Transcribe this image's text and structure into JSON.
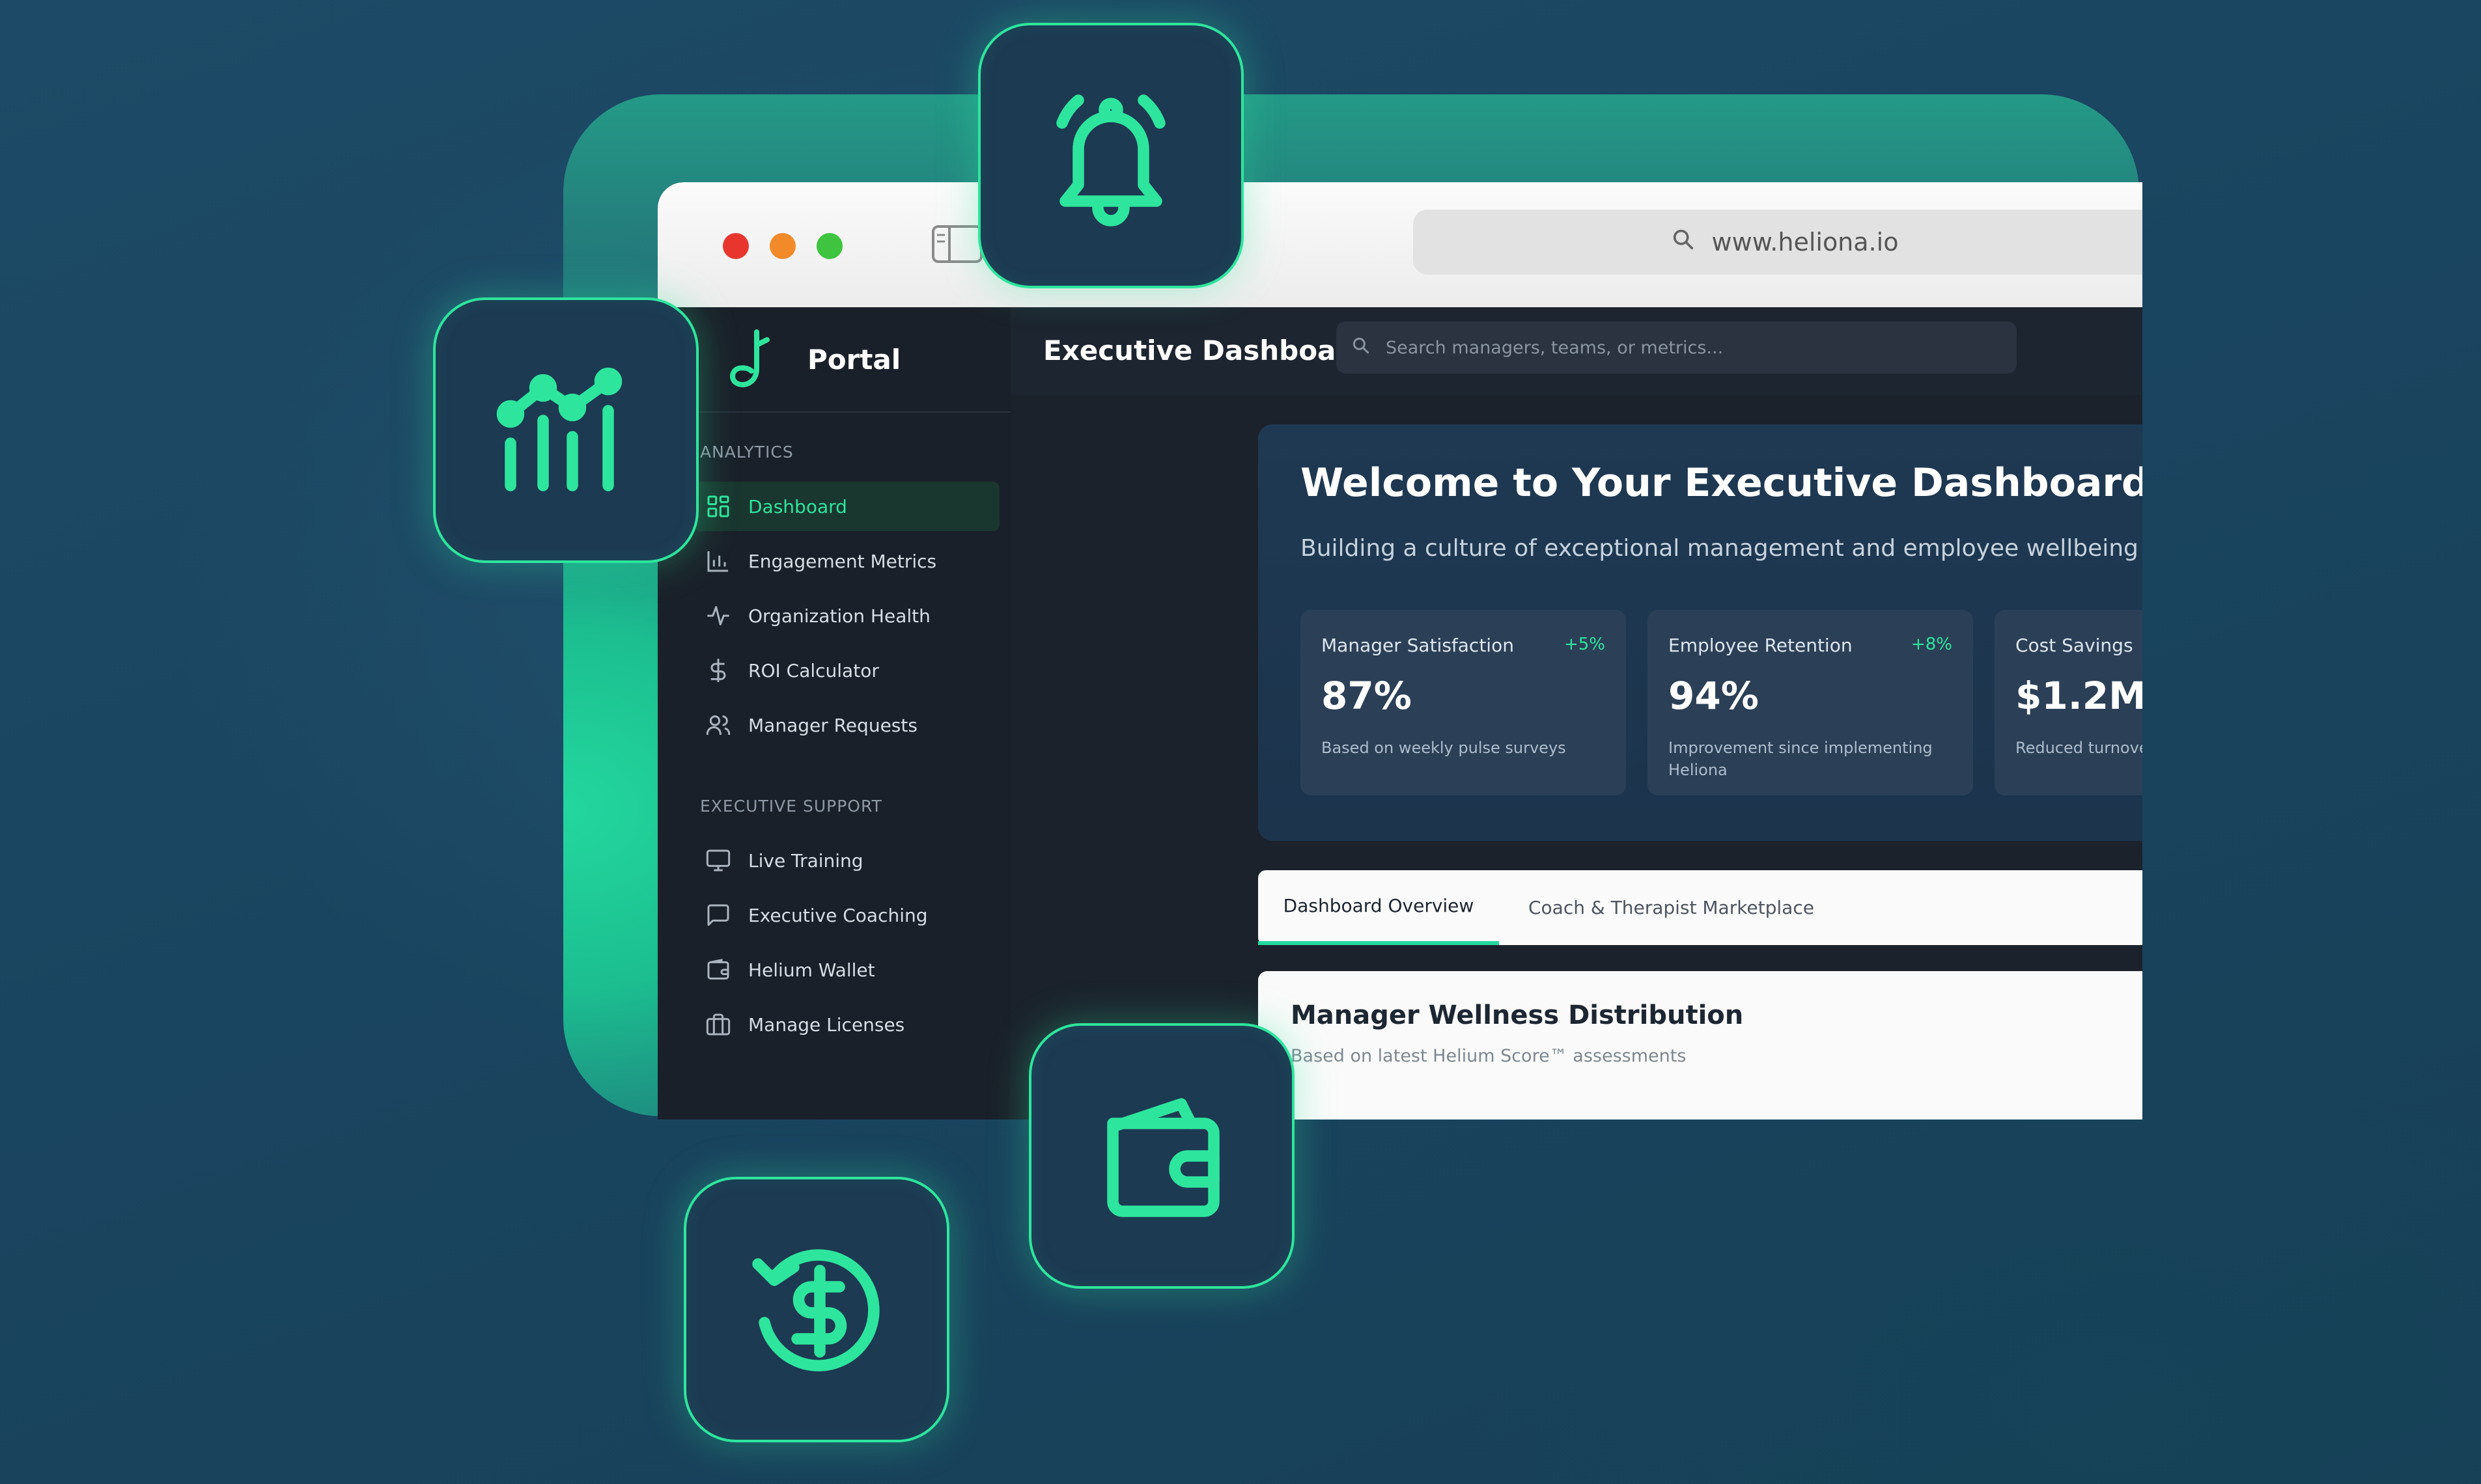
{
  "browser": {
    "url": "www.heliona.io"
  },
  "sidebar": {
    "brand": "Portal",
    "sections": [
      {
        "label": "ANALYTICS",
        "items": [
          {
            "label": "Dashboard",
            "icon": "grid-icon",
            "active": true
          },
          {
            "label": "Engagement Metrics",
            "icon": "bar-chart-icon"
          },
          {
            "label": "Organization Health",
            "icon": "pulse-icon"
          },
          {
            "label": "ROI Calculator",
            "icon": "dollar-icon"
          },
          {
            "label": "Manager Requests",
            "icon": "users-icon"
          }
        ]
      },
      {
        "label": "EXECUTIVE SUPPORT",
        "items": [
          {
            "label": "Live Training",
            "icon": "monitor-icon"
          },
          {
            "label": "Executive Coaching",
            "icon": "chat-icon"
          },
          {
            "label": "Helium Wallet",
            "icon": "wallet-icon"
          },
          {
            "label": "Manage Licenses",
            "icon": "briefcase-icon"
          }
        ]
      }
    ]
  },
  "header": {
    "title": "Executive Dashboard",
    "search_placeholder": "Search managers, teams, or metrics..."
  },
  "welcome": {
    "title": "Welcome to Your Executive Dashboard",
    "subtitle": "Building a culture of exceptional management and employee wellbeing",
    "stats": [
      {
        "label": "Manager Satisfaction",
        "change": "+5%",
        "value": "87%",
        "note": "Based on weekly pulse surveys"
      },
      {
        "label": "Employee Retention",
        "change": "+8%",
        "value": "94%",
        "note": "Improvement since implementing Heliona"
      },
      {
        "label": "Cost Savings",
        "change": "",
        "value": "$1.2M",
        "note": "Reduced turnover"
      }
    ]
  },
  "tabs": [
    {
      "label": "Dashboard Overview",
      "active": true
    },
    {
      "label": "Coach & Therapist Marketplace",
      "active": false
    }
  ],
  "wellness_card": {
    "title": "Manager Wellness Distribution",
    "subtitle": "Based on latest Helium Score™ assessments"
  },
  "floating_icons": [
    "bell-icon",
    "line-chart-icon",
    "wallet-icon",
    "dollar-refresh-icon"
  ],
  "colors": {
    "accent": "#2ee59d",
    "sidebar_bg": "#1a2029",
    "welcome_bg": "#1f3953",
    "icon_tile_bg": "#1c3a52"
  }
}
